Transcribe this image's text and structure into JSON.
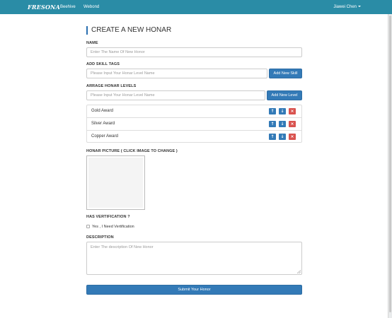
{
  "nav": {
    "brand": "FRESONA",
    "links": [
      "Beehive",
      "Webond"
    ],
    "user": "Jiawei Chen"
  },
  "form": {
    "title": "CREATE A NEW HONAR",
    "name": {
      "label": "NAME",
      "placeholder": "Enter The Name Of New Honor"
    },
    "skill_tags": {
      "label": "ADD SKILL TAGS",
      "placeholder": "Please Input Your Honar Level Name",
      "button": "Add New Skill"
    },
    "honar_levels": {
      "label": "ARRAGE HONAR LEVELS",
      "placeholder": "Please Input Your Honar Level Name",
      "button": "Add New Level",
      "items": [
        "Gold Award",
        "Silver Award",
        "Copper Award"
      ]
    },
    "picture": {
      "label": "HONAR PICTURE ( CLICK IMAGE TO CHANGE )"
    },
    "verification": {
      "label": "HAS VERTIFICATION ?",
      "option": "Yes , I Need Vertification",
      "checked": false
    },
    "description": {
      "label": "DESCRIPTION",
      "placeholder": "Enter The description Of New Honor"
    },
    "submit": "Submit Your Honor"
  },
  "colors": {
    "navbar": "#2a8ca6",
    "primary": "#337ab7",
    "danger": "#d9534f"
  },
  "icons": {
    "move_up": "arrow-up-icon",
    "move_down": "arrow-down-icon",
    "delete": "close-icon",
    "dropdown": "caret-down-icon"
  }
}
